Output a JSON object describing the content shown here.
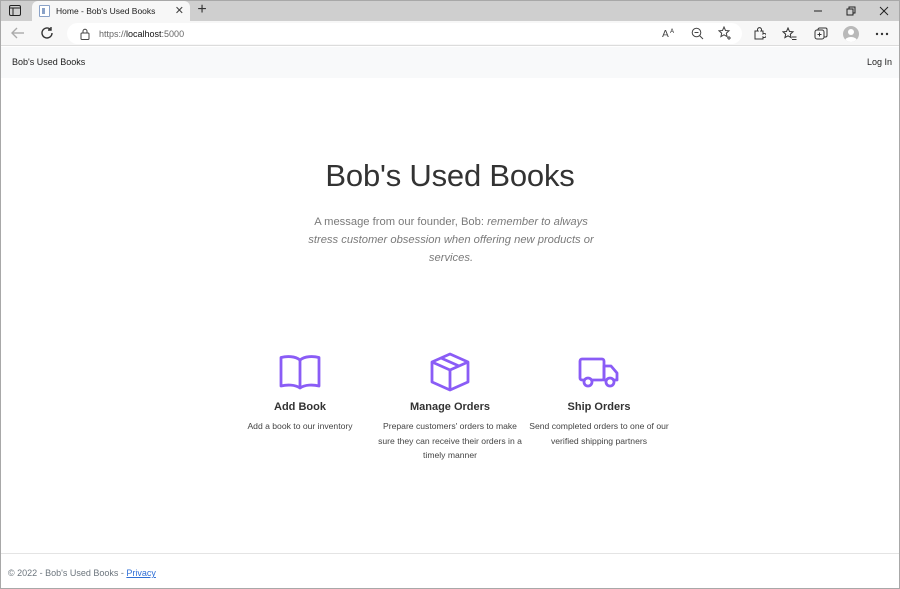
{
  "browser": {
    "tab_title": "Home - Bob's Used Books",
    "url_prefix": "https://",
    "url_host": "localhost",
    "url_suffix": ":5000"
  },
  "site": {
    "brand": "Bob's Used Books",
    "login": "Log In"
  },
  "hero": {
    "title": "Bob's Used Books",
    "message_plain": "A message from our founder, Bob: ",
    "message_italic": "remember to always stress customer obsession when offering new products or services."
  },
  "features": [
    {
      "icon": "book-icon",
      "title": "Add Book",
      "description": "Add a book to our inventory"
    },
    {
      "icon": "box-icon",
      "title": "Manage Orders",
      "description": "Prepare customers' orders to make sure they can receive their orders in a timely manner"
    },
    {
      "icon": "truck-icon",
      "title": "Ship Orders",
      "description": "Send completed orders to one of our verified shipping partners"
    }
  ],
  "footer": {
    "text": "© 2022 - Bob's Used Books - ",
    "privacy": "Privacy"
  },
  "colors": {
    "accent": "#8a5cf6",
    "nav_bg": "#f8f9fa",
    "link": "#2f6fd6"
  }
}
